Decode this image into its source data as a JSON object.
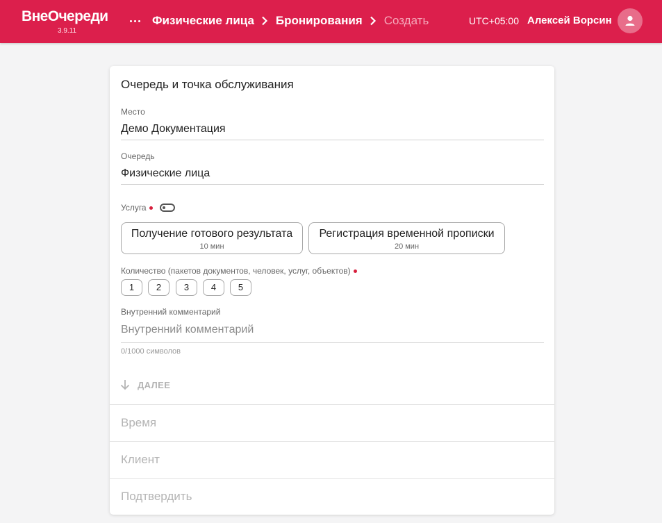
{
  "app": {
    "name": "ВнеОчереди",
    "version": "3.9.11"
  },
  "breadcrumbs": [
    "Физические лица",
    "Бронирования",
    "Создать"
  ],
  "header": {
    "timezone": "UTC+05:00",
    "user_name": "Алексей Ворсин"
  },
  "form": {
    "section_title": "Очередь и точка обслуживания",
    "place": {
      "label": "Место",
      "value": "Демо Документация"
    },
    "queue": {
      "label": "Очередь",
      "value": "Физические лица"
    },
    "service": {
      "label": "Услуга",
      "options": [
        {
          "name": "Получение готового результата",
          "duration": "10 мин"
        },
        {
          "name": "Регистрация временной прописки",
          "duration": "20 мин"
        }
      ]
    },
    "quantity": {
      "label": "Количество (пакетов документов, человек, услуг, объектов)",
      "options": [
        "1",
        "2",
        "3",
        "4",
        "5"
      ]
    },
    "comment": {
      "label": "Внутренний комментарий",
      "value": "",
      "placeholder": "Внутренний комментарий",
      "counter": "0/1000 символов"
    },
    "next_label": "ДАЛЕЕ"
  },
  "steps": [
    "Время",
    "Клиент",
    "Подтвердить"
  ],
  "colors": {
    "brand": "#dc1f4c",
    "required_dot": "#d71e3c",
    "background": "#f4f4f5"
  }
}
